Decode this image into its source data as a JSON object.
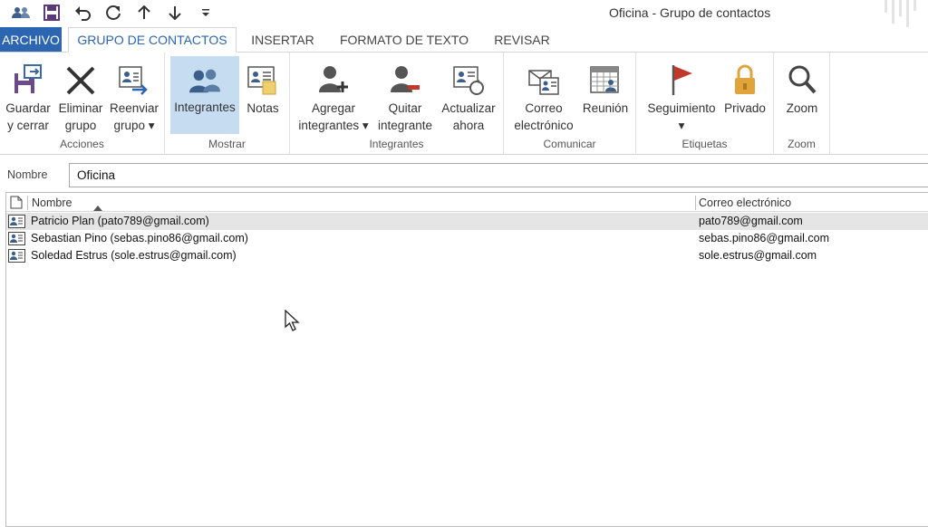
{
  "window": {
    "title": "Oficina - Grupo de contactos"
  },
  "quick_access": [
    {
      "icon": "contact-group-icon"
    },
    {
      "icon": "save-icon"
    },
    {
      "icon": "undo-icon"
    },
    {
      "icon": "redo-icon"
    },
    {
      "icon": "arrow-up-icon"
    },
    {
      "icon": "arrow-down-icon"
    },
    {
      "icon": "customize-qat-icon"
    }
  ],
  "tabs": [
    {
      "label": "ARCHIVO"
    },
    {
      "label": "GRUPO DE CONTACTOS",
      "active": true
    },
    {
      "label": "INSERTAR"
    },
    {
      "label": "FORMATO DE TEXTO"
    },
    {
      "label": "REVISAR"
    }
  ],
  "ribbon": {
    "acciones": {
      "label": "Acciones",
      "guardar": {
        "line1": "Guardar",
        "line2": "y cerrar",
        "icon": "save-close-icon"
      },
      "eliminar": {
        "line1": "Eliminar",
        "line2": "grupo",
        "icon": "delete-x-icon"
      },
      "reenviar": {
        "line1": "Reenviar",
        "line2": "grupo ▾",
        "icon": "forward-group-icon"
      }
    },
    "mostrar": {
      "label": "Mostrar",
      "integrantes": {
        "line1": "Integrantes",
        "icon": "members-icon"
      },
      "notas": {
        "line1": "Notas",
        "icon": "notes-icon"
      }
    },
    "integrantes": {
      "label": "Integrantes",
      "agregar": {
        "line1": "Agregar",
        "line2": "integrantes ▾",
        "icon": "add-member-icon"
      },
      "quitar": {
        "line1": "Quitar",
        "line2": "integrante",
        "icon": "remove-member-icon"
      },
      "actualizar": {
        "line1": "Actualizar",
        "line2": "ahora",
        "icon": "update-icon"
      }
    },
    "comunicar": {
      "label": "Comunicar",
      "correo": {
        "line1": "Correo",
        "line2": "electrónico",
        "icon": "email-icon"
      },
      "reunion": {
        "line1": "Reunión",
        "icon": "meeting-icon"
      }
    },
    "etiquetas": {
      "label": "Etiquetas",
      "seguimiento": {
        "line1": "Seguimiento",
        "line2": "▾",
        "icon": "flag-icon"
      },
      "privado": {
        "line1": "Privado",
        "icon": "lock-icon"
      }
    },
    "zoom": {
      "label": "Zoom",
      "zoom": {
        "line1": "Zoom",
        "icon": "magnifier-icon"
      }
    }
  },
  "name_field": {
    "label": "Nombre",
    "value": "Oficina"
  },
  "members": {
    "headers": {
      "name": "Nombre",
      "email": "Correo electrónico"
    },
    "rows": [
      {
        "name": "Patricio Plan (pato789@gmail.com)",
        "email": "pato789@gmail.com",
        "selected": true
      },
      {
        "name": "Sebastian Pino (sebas.pino86@gmail.com)",
        "email": "sebas.pino86@gmail.com"
      },
      {
        "name": "Soledad Estrus (sole.estrus@gmail.com)",
        "email": "sole.estrus@gmail.com"
      }
    ]
  },
  "colors": {
    "accent": "#2d66b0",
    "pressed": "#c6ddf1",
    "flag": "#c0392b",
    "lock": "#e0a43a"
  }
}
